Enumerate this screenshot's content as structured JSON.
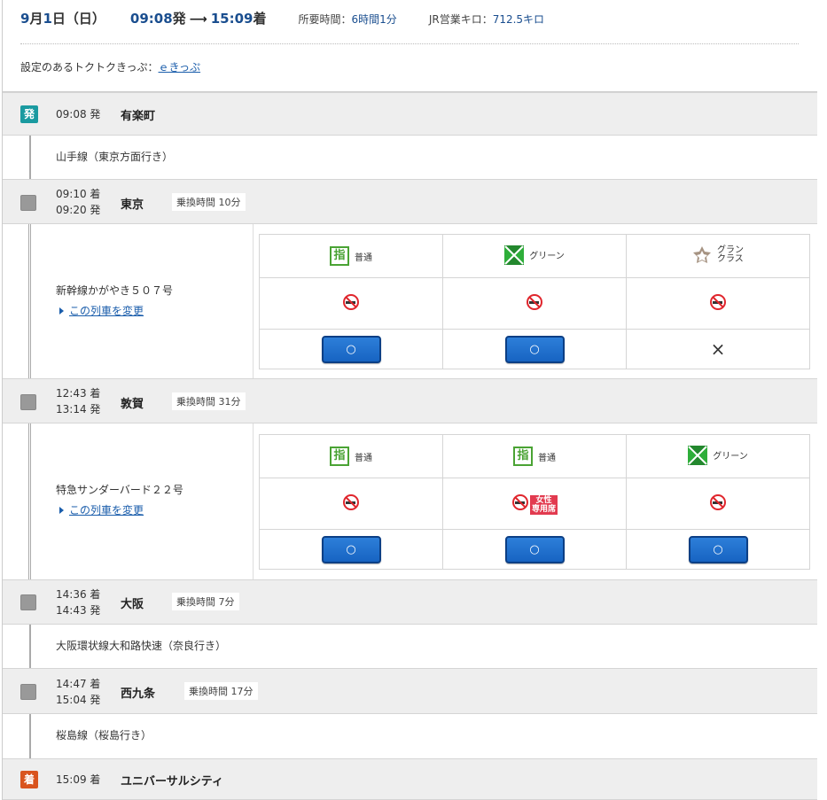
{
  "header": {
    "date_month": "9",
    "date_month_suffix": "月",
    "date_day": "1",
    "date_day_suffix": "日（日）",
    "dep_time": "09:08",
    "dep_suffix": "発",
    "arr_time": "15:09",
    "arr_suffix": "着",
    "duration_label": "所要時間：",
    "duration_value": "6時間1分",
    "distance_label": "JR営業キロ：",
    "distance_value": "712.5キロ",
    "deal_label": "設定のあるトクトクきっぷ：",
    "deal_link": "ｅきっぷ"
  },
  "stations": [
    {
      "type": "dep",
      "badge": "発",
      "time1": "09:08 発",
      "time2": "",
      "name": "有楽町",
      "transfer": ""
    },
    {
      "type": "via",
      "time1": "09:10 着",
      "time2": "09:20 発",
      "name": "東京",
      "transfer": "乗換時間 10分"
    },
    {
      "type": "via",
      "time1": "12:43 着",
      "time2": "13:14 発",
      "name": "敦賀",
      "transfer": "乗換時間 31分"
    },
    {
      "type": "via",
      "time1": "14:36 着",
      "time2": "14:43 発",
      "name": "大阪",
      "transfer": "乗換時間 7分"
    },
    {
      "type": "via",
      "time1": "14:47 着",
      "time2": "15:04 発",
      "name": "西九条",
      "transfer": "乗換時間 17分"
    },
    {
      "type": "arr",
      "badge": "着",
      "time1": "15:09 着",
      "time2": "",
      "name": "ユニバーサルシティ",
      "transfer": ""
    }
  ],
  "segments": [
    {
      "line": "山手線（東京方面行き）"
    },
    {
      "line": "新幹線かがやき５０７号",
      "change_link": "この列車を変更",
      "classes": [
        "普通",
        "グリーン",
        "グラン クラス"
      ],
      "ladies": [
        false,
        false,
        false
      ],
      "avail": [
        "○",
        "○",
        "×"
      ]
    },
    {
      "line": "特急サンダーバード２２号",
      "change_link": "この列車を変更",
      "classes": [
        "普通",
        "普通",
        "グリーン"
      ],
      "ladies": [
        false,
        true,
        false
      ],
      "avail": [
        "○",
        "○",
        "○"
      ]
    },
    {
      "line": "大阪環状線大和路快速（奈良行き）"
    },
    {
      "line": "桜島線（桜島行き）"
    }
  ],
  "labels": {
    "shitei_icon": "指",
    "grand_1": "グラン",
    "grand_2": "クラス",
    "ladies_1": "女性",
    "ladies_2": "専用席"
  },
  "colors": {
    "accent": "#1a4e8f",
    "dep_badge": "#1a9aa0",
    "arr_badge": "#d9541e",
    "button": "#1764c2",
    "green_car": "#2eae3a",
    "reserved": "#4aa334"
  }
}
